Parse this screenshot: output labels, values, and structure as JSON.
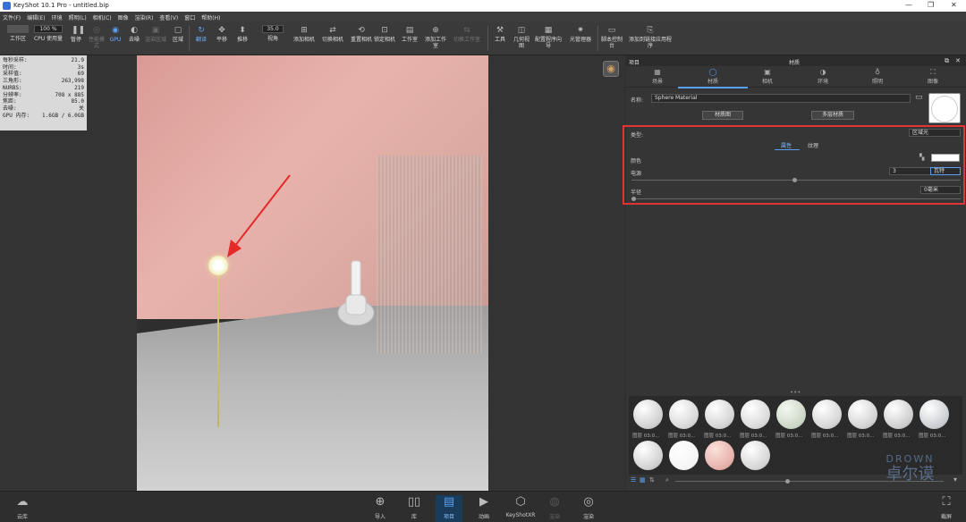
{
  "title_bar": {
    "title": "KeyShot 10.1 Pro  - untitled.bip",
    "minimize": "—",
    "maximize": "❐",
    "close": "✕"
  },
  "menu": [
    "文件(F)",
    "编辑(E)",
    "环境",
    "照明(L)",
    "相机(C)",
    "图像",
    "渲染(R)",
    "查看(V)",
    "窗口",
    "帮助(H)"
  ],
  "toolbar": {
    "workspace": "工作区",
    "cpu_percent": "100 %",
    "cpu_usage": "CPU 使用量",
    "pause": "暂停",
    "perf_mode": "性能模式",
    "gpu": "GPU",
    "denoise": "去噪",
    "render_region": "渲染区域",
    "region": "区域",
    "flip": "翻译",
    "pan": "平移",
    "push": "推移",
    "fov_value": "35.0",
    "fov": "视角",
    "add_camera": "添加相机",
    "switch_camera": "切换相机",
    "reset_camera": "重置相机",
    "lock_camera": "锁定相机",
    "studio": "工作室",
    "add_studio": "添加工作室",
    "switch_studio": "切换工作室",
    "tools": "工具",
    "geometry_view": "几何视图",
    "config_wizard": "配置程序向导",
    "light_manager": "光管理器",
    "script_console": "脚本控制台",
    "add_to_app": "添加到链接应用程序"
  },
  "stats": [
    [
      "每秒采样:",
      "21.9"
    ],
    [
      "时间:",
      "3s"
    ],
    [
      "采样值:",
      "69"
    ],
    [
      "三角形:",
      "263,998"
    ],
    [
      "NURBS:",
      "219"
    ],
    [
      "分辨率:",
      "708 x 885"
    ],
    [
      "焦距:",
      "85.0"
    ],
    [
      "去噪:",
      "关"
    ],
    [
      "GPU 内存:",
      "1.6GB / 6.0GB"
    ]
  ],
  "panel": {
    "left_title": "项目",
    "title": "材质",
    "tabs": [
      "场景",
      "材质",
      "相机",
      "环境",
      "照明",
      "图像"
    ],
    "name_label": "名称:",
    "name_value": "Sphere Material",
    "material_graph_btn": "材质图",
    "multi_material_btn": "多层材质",
    "type_label": "类型:",
    "type_value": "区域光",
    "subtab_props": "属性",
    "subtab_texture": "纹理",
    "color_label": "颜色",
    "power_label": "电源",
    "power_value": "3",
    "power_unit": "瓦特",
    "radius_label": "半径",
    "radius_value": "0毫米"
  },
  "library": {
    "ball_label": "图层 03:0...",
    "row1_count": 9,
    "row2_count": 4
  },
  "bottom": {
    "cloud": "云库",
    "import": "导入",
    "library": "库",
    "project": "项目",
    "animation": "动画",
    "keyshotxr": "KeyShotXR",
    "render_small": "渲染",
    "render": "渲染",
    "screenshot": "截屏"
  },
  "watermark": {
    "line1": "DROWN",
    "line2": "卓尔谟"
  }
}
